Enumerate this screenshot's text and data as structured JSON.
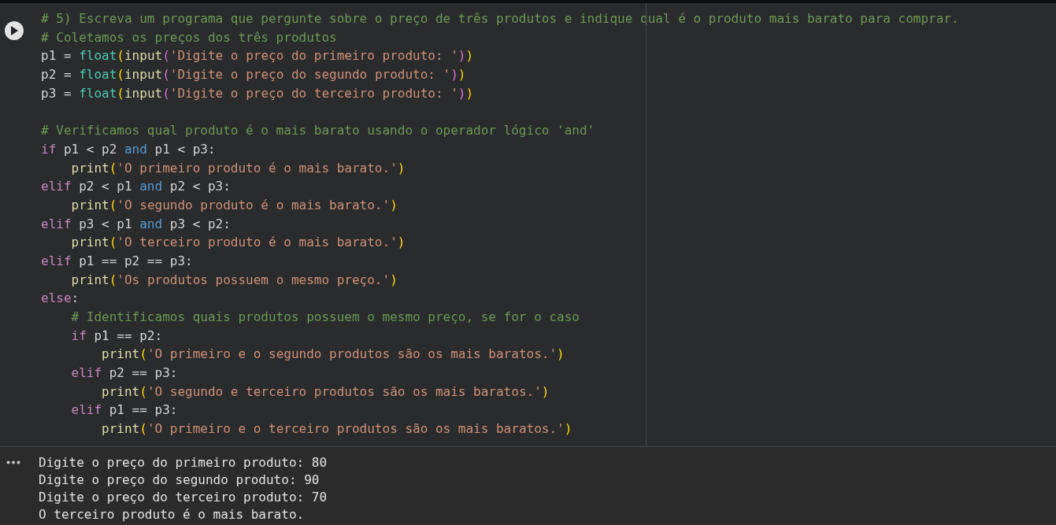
{
  "code_cell": {
    "lines": [
      {
        "kind": "code",
        "tokens": [
          {
            "kind": "comment",
            "text": "# 5) Escreva um programa que pergunte sobre o preço de três produtos e indique qual é o produto mais barato para comprar."
          }
        ]
      },
      {
        "kind": "code",
        "tokens": [
          {
            "kind": "comment",
            "text": "# Coletamos os preços dos três produtos"
          }
        ]
      },
      {
        "kind": "code",
        "tokens": [
          {
            "kind": "plain",
            "text": "p1 = "
          },
          {
            "kind": "builtin",
            "text": "float"
          },
          {
            "kind": "paren1",
            "text": "("
          },
          {
            "kind": "function",
            "text": "input"
          },
          {
            "kind": "paren2",
            "text": "("
          },
          {
            "kind": "string",
            "text": "'Digite o preço do primeiro produto: '"
          },
          {
            "kind": "paren2",
            "text": ")"
          },
          {
            "kind": "paren1",
            "text": ")"
          }
        ]
      },
      {
        "kind": "code",
        "tokens": [
          {
            "kind": "plain",
            "text": "p2 = "
          },
          {
            "kind": "builtin",
            "text": "float"
          },
          {
            "kind": "paren1",
            "text": "("
          },
          {
            "kind": "function",
            "text": "input"
          },
          {
            "kind": "paren2",
            "text": "("
          },
          {
            "kind": "string",
            "text": "'Digite o preço do segundo produto: '"
          },
          {
            "kind": "paren2",
            "text": ")"
          },
          {
            "kind": "paren1",
            "text": ")"
          }
        ]
      },
      {
        "kind": "code",
        "tokens": [
          {
            "kind": "plain",
            "text": "p3 = "
          },
          {
            "kind": "builtin",
            "text": "float"
          },
          {
            "kind": "paren1",
            "text": "("
          },
          {
            "kind": "function",
            "text": "input"
          },
          {
            "kind": "paren2",
            "text": "("
          },
          {
            "kind": "string",
            "text": "'Digite o preço do terceiro produto: '"
          },
          {
            "kind": "paren2",
            "text": ")"
          },
          {
            "kind": "paren1",
            "text": ")"
          }
        ]
      },
      {
        "kind": "blank"
      },
      {
        "kind": "code",
        "tokens": [
          {
            "kind": "comment",
            "text": "# Verificamos qual produto é o mais barato usando o operador lógico 'and'"
          }
        ]
      },
      {
        "kind": "code",
        "tokens": [
          {
            "kind": "keyword",
            "text": "if"
          },
          {
            "kind": "plain",
            "text": " p1 < p2 "
          },
          {
            "kind": "operator",
            "text": "and"
          },
          {
            "kind": "plain",
            "text": " p1 < p3:"
          }
        ]
      },
      {
        "kind": "code",
        "tokens": [
          {
            "kind": "function",
            "text": "    print"
          },
          {
            "kind": "paren1",
            "text": "("
          },
          {
            "kind": "string",
            "text": "'O primeiro produto é o mais barato.'"
          },
          {
            "kind": "paren1",
            "text": ")"
          }
        ]
      },
      {
        "kind": "code",
        "tokens": [
          {
            "kind": "keyword",
            "text": "elif"
          },
          {
            "kind": "plain",
            "text": " p2 < p1 "
          },
          {
            "kind": "operator",
            "text": "and"
          },
          {
            "kind": "plain",
            "text": " p2 < p3:"
          }
        ]
      },
      {
        "kind": "code",
        "tokens": [
          {
            "kind": "function",
            "text": "    print"
          },
          {
            "kind": "paren1",
            "text": "("
          },
          {
            "kind": "string",
            "text": "'O segundo produto é o mais barato.'"
          },
          {
            "kind": "paren1",
            "text": ")"
          }
        ]
      },
      {
        "kind": "code",
        "tokens": [
          {
            "kind": "keyword",
            "text": "elif"
          },
          {
            "kind": "plain",
            "text": " p3 < p1 "
          },
          {
            "kind": "operator",
            "text": "and"
          },
          {
            "kind": "plain",
            "text": " p3 < p2:"
          }
        ]
      },
      {
        "kind": "code",
        "tokens": [
          {
            "kind": "function",
            "text": "    print"
          },
          {
            "kind": "paren1",
            "text": "("
          },
          {
            "kind": "string",
            "text": "'O terceiro produto é o mais barato.'"
          },
          {
            "kind": "paren1",
            "text": ")"
          }
        ]
      },
      {
        "kind": "code",
        "tokens": [
          {
            "kind": "keyword",
            "text": "elif"
          },
          {
            "kind": "plain",
            "text": " p1 == p2 == p3:"
          }
        ]
      },
      {
        "kind": "code",
        "tokens": [
          {
            "kind": "function",
            "text": "    print"
          },
          {
            "kind": "paren1",
            "text": "("
          },
          {
            "kind": "string",
            "text": "'Os produtos possuem o mesmo preço.'"
          },
          {
            "kind": "paren1",
            "text": ")"
          }
        ]
      },
      {
        "kind": "code",
        "tokens": [
          {
            "kind": "keyword",
            "text": "else"
          },
          {
            "kind": "plain",
            "text": ":"
          }
        ]
      },
      {
        "kind": "code",
        "tokens": [
          {
            "kind": "comment",
            "text": "    # Identificamos quais produtos possuem o mesmo preço, se for o caso"
          }
        ]
      },
      {
        "kind": "code",
        "tokens": [
          {
            "kind": "keyword",
            "text": "    if"
          },
          {
            "kind": "plain",
            "text": " p1 == p2:"
          }
        ]
      },
      {
        "kind": "code",
        "tokens": [
          {
            "kind": "function",
            "text": "        print"
          },
          {
            "kind": "paren1",
            "text": "("
          },
          {
            "kind": "string",
            "text": "'O primeiro e o segundo produtos são os mais baratos.'"
          },
          {
            "kind": "paren1",
            "text": ")"
          }
        ]
      },
      {
        "kind": "code",
        "tokens": [
          {
            "kind": "keyword",
            "text": "    elif"
          },
          {
            "kind": "plain",
            "text": " p2 == p3:"
          }
        ]
      },
      {
        "kind": "code",
        "tokens": [
          {
            "kind": "function",
            "text": "        print"
          },
          {
            "kind": "paren1",
            "text": "("
          },
          {
            "kind": "string",
            "text": "'O segundo e terceiro produtos são os mais baratos.'"
          },
          {
            "kind": "paren1",
            "text": ")"
          }
        ]
      },
      {
        "kind": "code",
        "tokens": [
          {
            "kind": "keyword",
            "text": "    elif"
          },
          {
            "kind": "plain",
            "text": " p1 == p3:"
          }
        ]
      },
      {
        "kind": "code",
        "tokens": [
          {
            "kind": "function",
            "text": "        print"
          },
          {
            "kind": "paren1",
            "text": "("
          },
          {
            "kind": "string",
            "text": "'O primeiro e o terceiro produtos são os mais baratos.'"
          },
          {
            "kind": "paren1",
            "text": ")"
          }
        ]
      }
    ]
  },
  "output": {
    "lines": [
      "Digite o preço do primeiro produto: 80",
      "Digite o preço do segundo produto: 90",
      "Digite o preço do terceiro produto: 70",
      "O terceiro produto é o mais barato."
    ]
  }
}
